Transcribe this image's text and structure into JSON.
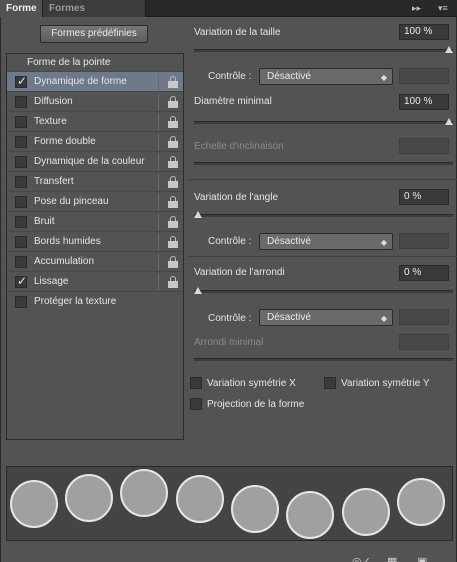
{
  "tabs": {
    "active": "Forme",
    "inactive": "Formes prédéfinies"
  },
  "tabbar_icons": {
    "collapse": "double-chevron-icon",
    "menu": "panel-menu-icon"
  },
  "preset_button": "Formes prédéfinies",
  "list": {
    "header": "Forme de la pointe",
    "items": [
      {
        "label": "Dynamique de forme",
        "checked": true,
        "selected": true
      },
      {
        "label": "Diffusion",
        "checked": false
      },
      {
        "label": "Texture",
        "checked": false
      },
      {
        "label": "Forme double",
        "checked": false
      },
      {
        "label": "Dynamique de la couleur",
        "checked": false
      },
      {
        "label": "Transfert",
        "checked": false
      },
      {
        "label": "Pose du pinceau",
        "checked": false
      },
      {
        "label": "Bruit",
        "checked": false
      },
      {
        "label": "Bords humides",
        "checked": false
      },
      {
        "label": "Accumulation",
        "checked": false
      },
      {
        "label": "Lissage",
        "checked": true
      },
      {
        "label": "Protéger la texture",
        "checked": false
      }
    ]
  },
  "settings": {
    "size_jitter": {
      "label": "Variation de la taille",
      "value": "100 %",
      "slider": 1.0
    },
    "control1": {
      "label": "Contrôle :",
      "value": "Désactivé"
    },
    "min_diameter": {
      "label": "Diamètre minimal",
      "value": "100 %",
      "slider": 1.0
    },
    "tilt_scale": {
      "label": "Echelle d'inclinaison"
    },
    "angle_jitter": {
      "label": "Variation de l'angle",
      "value": "0 %",
      "slider": 0.0
    },
    "control2": {
      "label": "Contrôle :",
      "value": "Désactivé"
    },
    "roundness_jitter": {
      "label": "Variation de l'arrondi",
      "value": "0 %",
      "slider": 0.0
    },
    "control3": {
      "label": "Contrôle :",
      "value": "Désactivé"
    },
    "min_roundness": {
      "label": "Arrondi minimal"
    },
    "flip_x": {
      "label": "Variation symétrie X",
      "checked": false
    },
    "flip_y": {
      "label": "Variation symétrie Y",
      "checked": false
    },
    "brush_projection": {
      "label": "Projection de la forme",
      "checked": false
    }
  },
  "bottom_icons": [
    "eye-brush-icon",
    "grid-panel-icon",
    "new-preset-icon"
  ],
  "colors": {
    "panel_bg": "#535353",
    "selection": "#6c7a8c",
    "dark": "#282828"
  }
}
